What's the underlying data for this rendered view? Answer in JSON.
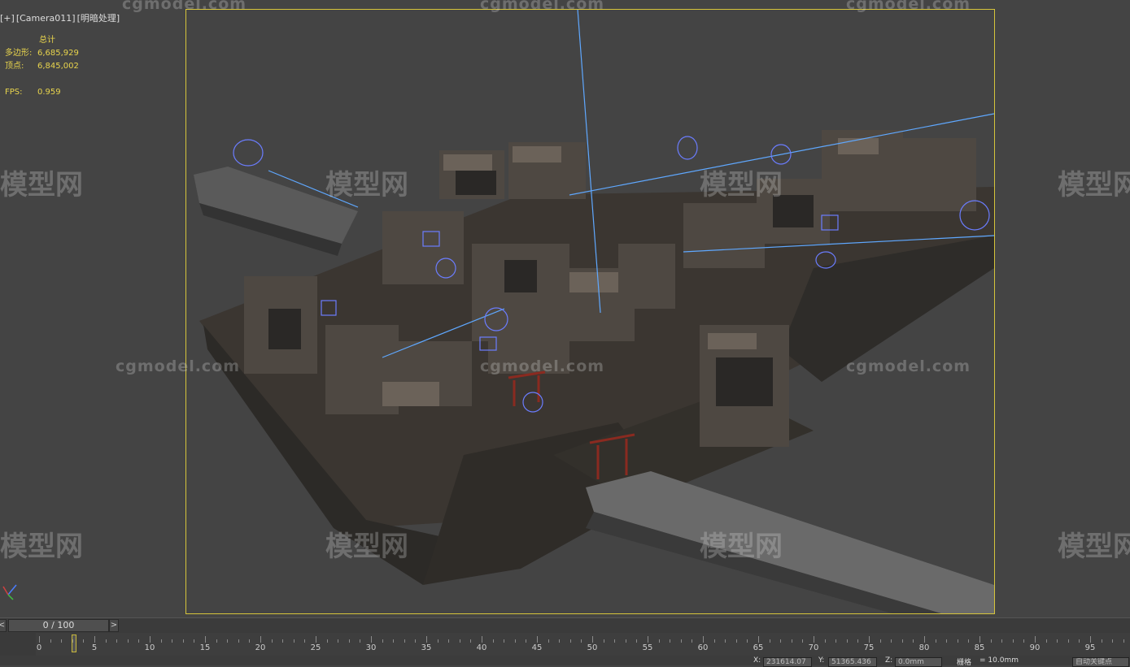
{
  "viewport": {
    "label_parts": [
      "[+]",
      "[Camera011]",
      "[明暗处理]"
    ],
    "stats": {
      "header": "总计",
      "polys_label": "多边形:",
      "polys_value": "6,685,929",
      "verts_label": "顶点:",
      "verts_value": "6,845,002",
      "fps_label": "FPS:",
      "fps_value": "0.959"
    },
    "watermark_cg": "cgmodel.com",
    "watermark_mx": "模型网",
    "frame_color": "#d6c53b"
  },
  "timeline": {
    "prev": "<",
    "next": ">",
    "frame_display": "0 / 100",
    "ticks": [
      "0",
      "5",
      "10",
      "15",
      "20",
      "25",
      "30",
      "35",
      "40",
      "45",
      "50",
      "55",
      "60",
      "65",
      "70",
      "75",
      "80",
      "85",
      "90",
      "95"
    ]
  },
  "statusbar": {
    "x_label": "X:",
    "x_value": "231614.07",
    "y_label": "Y:",
    "y_value": "51365.436",
    "z_label": "Z:",
    "z_value": "0.0mm",
    "grid_label": "栅格",
    "grid_value": "= 10.0mm",
    "autokey_label": "自动关键点"
  }
}
